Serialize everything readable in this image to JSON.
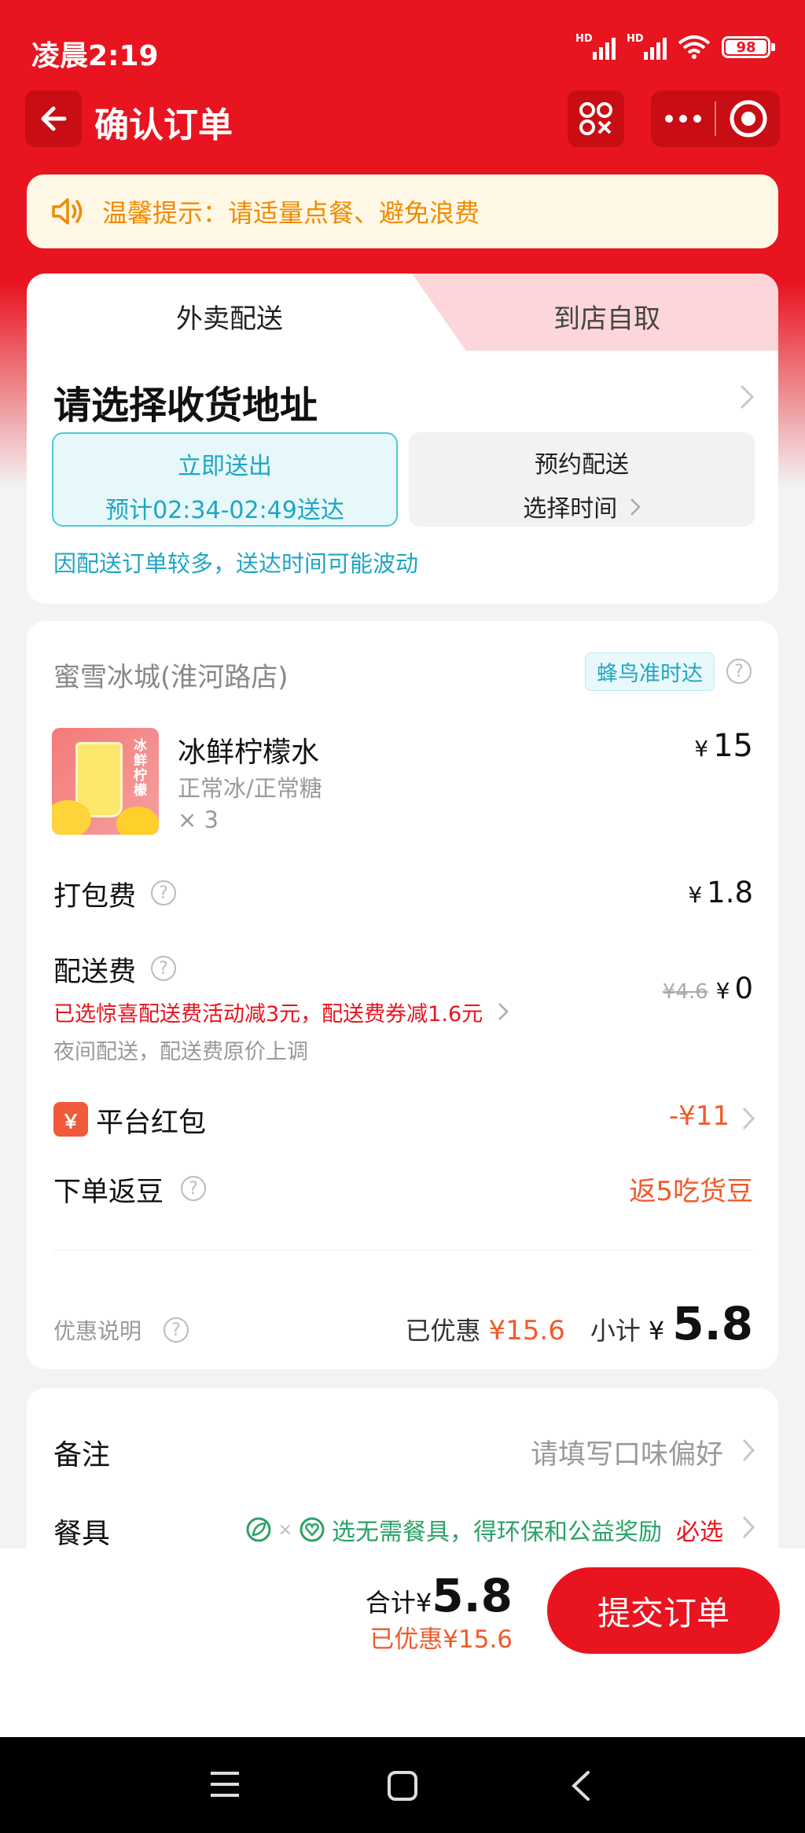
{
  "status": {
    "time": "凌晨2:19",
    "hd1": "HD",
    "hd2": "HD",
    "battery": "98"
  },
  "nav": {
    "title": "确认订单"
  },
  "notice": {
    "text": "温馨提示：请适量点餐、避免浪费"
  },
  "delivery": {
    "tabs": [
      "外卖配送",
      "到店自取"
    ],
    "address_prompt": "请选择收货地址",
    "option_now": {
      "title": "立即送出",
      "eta": "预计02:34-02:49送达"
    },
    "option_later": {
      "title": "预约配送",
      "action": "选择时间"
    },
    "note": "因配送订单较多，送达时间可能波动"
  },
  "order": {
    "store": "蜜雪冰城(淮河路店)",
    "badge": "蜂鸟准时达",
    "product": {
      "image_text": "冰鲜柠檬",
      "name": "冰鲜柠檬水",
      "spec": "正常冰/正常糖",
      "qty": "× 3",
      "price": "15"
    },
    "packing": {
      "label": "打包费",
      "value": "1.8"
    },
    "shipping": {
      "label": "配送费",
      "promo": "已选惊喜配送费活动减3元，配送费券减1.6元",
      "note": "夜间配送，配送费原价上调",
      "original": "¥4.6",
      "value": "0"
    },
    "redpacket": {
      "label": "平台红包",
      "value": "-¥11"
    },
    "beans": {
      "label": "下单返豆",
      "value": "返5吃货豆"
    },
    "discount_note": "优惠说明",
    "discount_label": "已优惠",
    "discount_value": "¥15.6",
    "subtotal_label": "小计",
    "subtotal": "5.8"
  },
  "extras": {
    "remark_label": "备注",
    "remark_placeholder": "请填写口味偏好",
    "tableware_label": "餐具",
    "tableware_tip": "选无需餐具，得环保和公益奖励",
    "tableware_required": "必选"
  },
  "footer": {
    "total_label": "合计¥",
    "total": "5.8",
    "discount": "已优惠¥15.6",
    "submit": "提交订单"
  },
  "symbols": {
    "yen": "¥",
    "yen_fullwidth": "￥",
    "question": "?",
    "times": "×"
  }
}
